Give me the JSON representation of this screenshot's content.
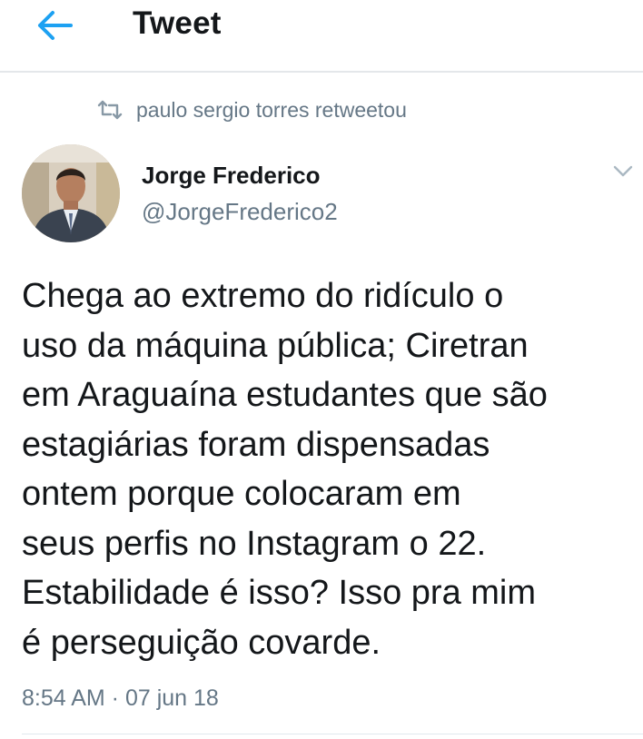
{
  "header": {
    "title": "Tweet",
    "back_icon": "arrow-left-icon",
    "accent_color": "#1da1f2"
  },
  "retweet_context": {
    "icon": "retweet-icon",
    "text": "paulo sergio torres retweetou"
  },
  "tweet": {
    "author_name": "Jorge Frederico",
    "author_handle": "@JorgeFrederico2",
    "menu_icon": "chevron-down-icon",
    "text": "Chega ao extremo do ridículo o\nuso da máquina pública; Ciretran\nem Araguaína estudantes que são\nestagiárias foram dispensadas\nontem porque colocaram em\nseus perfis no Instagram o 22.\nEstabilidade é isso? Isso pra mim\né perseguição covarde.",
    "timestamp": "8:54 AM · 07 jun 18"
  }
}
